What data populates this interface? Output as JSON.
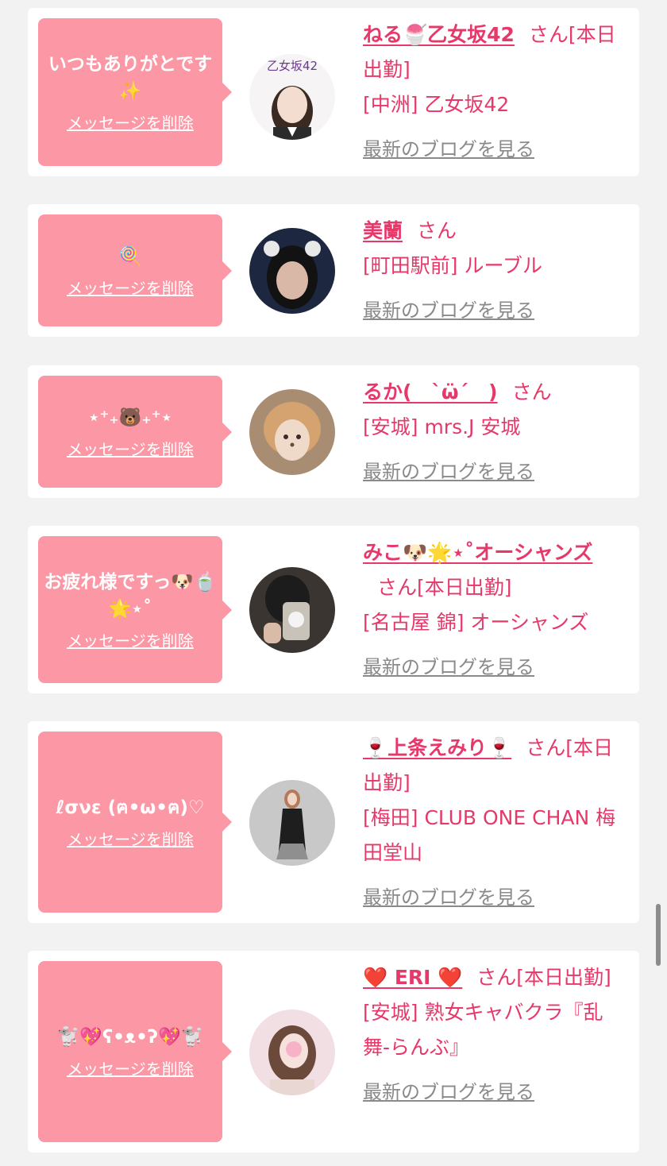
{
  "cards": [
    {
      "message": "いつもありがとです✨",
      "delete_label": "メッセージを削除",
      "name": "ねる🍧乙女坂42",
      "suffix": "さん[本日出勤]",
      "shop": "[中洲] 乙女坂42",
      "blog_label": "最新のブログを見る",
      "avatar_logo": "乙女坂42"
    },
    {
      "message": "🍭",
      "delete_label": "メッセージを削除",
      "name": "美蘭",
      "suffix": "さん",
      "shop": "[町田駅前] ルーブル",
      "blog_label": "最新のブログを見る"
    },
    {
      "message": "⋆⁺₊🐻₊⁺⋆",
      "delete_label": "メッセージを削除",
      "name": "るか(　`ω̈´　)",
      "suffix": "さん",
      "shop": "[安城] mrs.J 安城",
      "blog_label": "最新のブログを見る"
    },
    {
      "message": "お疲れ様ですっ🐶🍵🌟⋆˚",
      "delete_label": "メッセージを削除",
      "name": "みこ🐶🌟⋆˚オーシャンズ",
      "suffix": "さん[本日出勤]",
      "shop": "[名古屋 錦] オーシャンズ",
      "blog_label": "最新のブログを見る"
    },
    {
      "message": "ℓσνε (ฅ•ω•ฅ)♡",
      "delete_label": "メッセージを削除",
      "name": "🍷上条えみり🍷",
      "suffix": "さん[本日出勤]",
      "shop": "[梅田] CLUB ONE CHAN 梅田堂山",
      "blog_label": "最新のブログを見る"
    },
    {
      "message": "🐩💖ʕ•ᴥ•ʔ💖🐩",
      "delete_label": "メッセージを削除",
      "name": "❤️ ERI ❤️",
      "suffix": "さん[本日出勤]",
      "shop": "[安城] 熟女キャバクラ『乱舞-らんぶ』",
      "blog_label": "最新のブログを見る"
    }
  ],
  "colors": {
    "accent": "#e7386a",
    "bubble": "#fc97a5",
    "background": "#f2f2f2",
    "muted": "#8a8a8a"
  }
}
